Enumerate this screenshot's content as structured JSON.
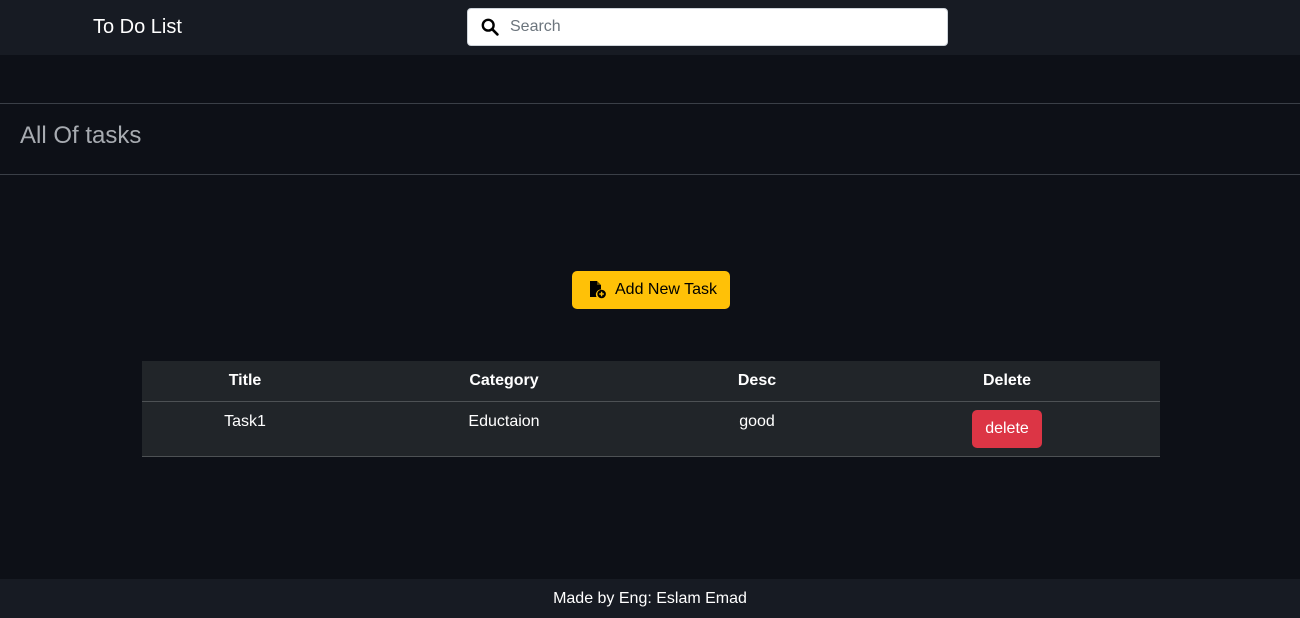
{
  "navbar": {
    "brand": "To Do List",
    "search_placeholder": "Search",
    "search_value": "",
    "search_icon": "magnifying-glass"
  },
  "page": {
    "title": "All Of tasks"
  },
  "actions": {
    "add_label": "Add New Task",
    "add_icon": "file-circle-plus",
    "add_color": "#ffc107"
  },
  "table": {
    "columns": [
      "Title",
      "Category",
      "Desc",
      "Delete"
    ],
    "rows": [
      {
        "title": "Task1",
        "category": "Eductaion",
        "desc": "good",
        "delete_label": "delete"
      }
    ],
    "delete_color": "#dc3545"
  },
  "footer": {
    "text": "Made by Eng: Eslam Emad"
  }
}
